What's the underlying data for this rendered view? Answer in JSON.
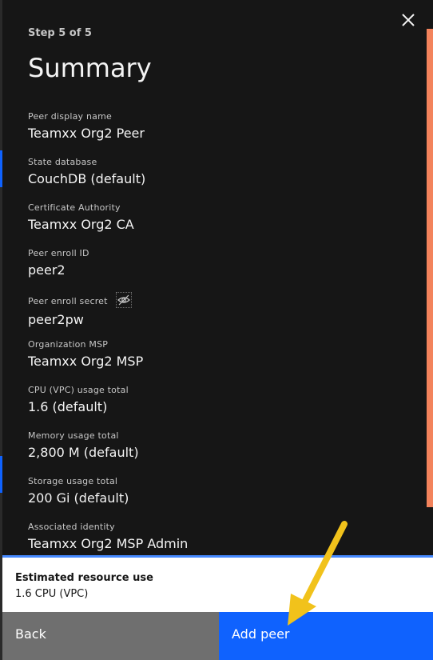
{
  "step": "Step 5 of 5",
  "title": "Summary",
  "fields": [
    {
      "label": "Peer display name",
      "value": "Teamxx Org2 Peer"
    },
    {
      "label": "State database",
      "value": "CouchDB (default)"
    },
    {
      "label": "Certificate Authority",
      "value": "Teamxx Org2 CA"
    },
    {
      "label": "Peer enroll ID",
      "value": "peer2"
    },
    {
      "label": "Peer enroll secret",
      "value": "peer2pw"
    },
    {
      "label": "Organization MSP",
      "value": "Teamxx Org2 MSP"
    },
    {
      "label": "CPU (VPC) usage total",
      "value": "1.6 (default)"
    },
    {
      "label": "Memory usage total",
      "value": "2,800 M (default)"
    },
    {
      "label": "Storage usage total",
      "value": "200 Gi (default)"
    },
    {
      "label": "Associated identity",
      "value": "Teamxx Org2 MSP Admin"
    }
  ],
  "estimate": {
    "title": "Estimated resource use",
    "value": "1.6 CPU (VPC)"
  },
  "buttons": {
    "back": "Back",
    "add": "Add peer"
  },
  "icons": {
    "close": "close-icon",
    "eye": "eye-slash-icon",
    "annotation": "arrow-annotation"
  },
  "colors": {
    "primary": "#0f62fe",
    "secondary": "#6f6f6f",
    "scroll_thumb": "#f3835c",
    "panel_bg": "#161616",
    "annotation": "#f1c21b"
  }
}
